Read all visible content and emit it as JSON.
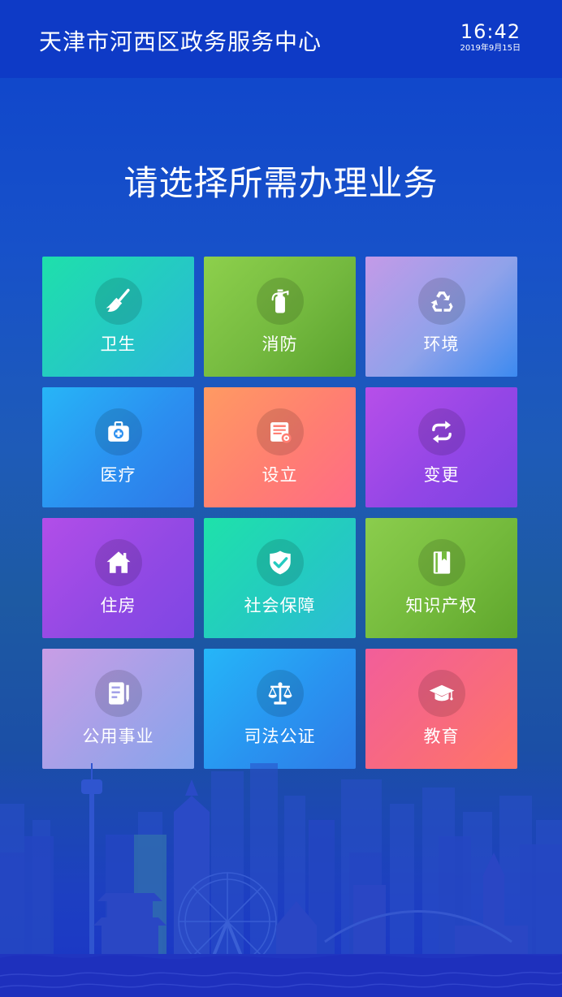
{
  "header": {
    "title": "天津市河西区政务服务中心",
    "time": "16:42",
    "date": "2019年9月15日"
  },
  "page_title": "请选择所需办理业务",
  "tiles": [
    {
      "label": "卫生",
      "icon": "broom-icon",
      "color": "#1ee0ab"
    },
    {
      "label": "消防",
      "icon": "fire-extinguisher-icon",
      "color": "#8dd04c"
    },
    {
      "label": "环境",
      "icon": "recycle-icon",
      "color": "#c49ae8"
    },
    {
      "label": "医疗",
      "icon": "medical-kit-icon",
      "color": "#27b5f7"
    },
    {
      "label": "设立",
      "icon": "document-settings-icon",
      "color": "#ff9a62"
    },
    {
      "label": "变更",
      "icon": "exchange-arrows-icon",
      "color": "#b74fe9"
    },
    {
      "label": "住房",
      "icon": "house-icon",
      "color": "#b24ee8"
    },
    {
      "label": "社会保障",
      "icon": "shield-check-icon",
      "color": "#1ee2aa"
    },
    {
      "label": "知识产权",
      "icon": "book-icon",
      "color": "#8bcd4d"
    },
    {
      "label": "公用事业",
      "icon": "notepad-pen-icon",
      "color": "#c99de6"
    },
    {
      "label": "司法公证",
      "icon": "balance-scale-icon",
      "color": "#25b6f8"
    },
    {
      "label": "教育",
      "icon": "graduation-cap-icon",
      "color": "#f25e9a"
    }
  ]
}
